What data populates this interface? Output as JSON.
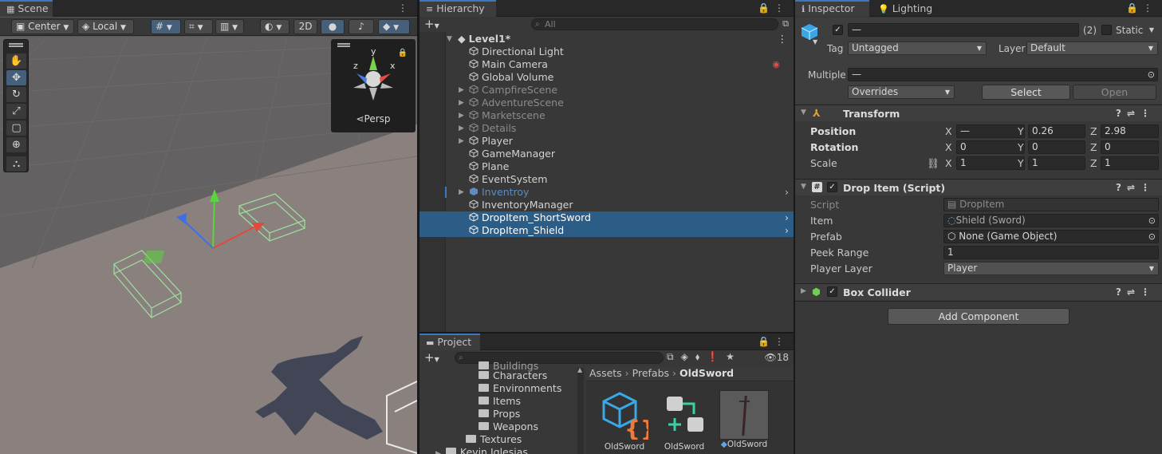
{
  "scene": {
    "tab": "Scene",
    "pivot": "Center",
    "space": "Local",
    "mode_2d": "2D",
    "persp": "Persp",
    "gizmo_axis_y": "y",
    "gizmo_axis_z": "z",
    "gizmo_axis_x": "x"
  },
  "hierarchy": {
    "tab": "Hierarchy",
    "search_placeholder": "All",
    "root": "Level1*",
    "items": [
      {
        "label": "Directional Light"
      },
      {
        "label": "Main Camera"
      },
      {
        "label": "Global Volume"
      },
      {
        "label": "CampfireScene"
      },
      {
        "label": "AdventureScene"
      },
      {
        "label": "Marketscene"
      },
      {
        "label": "Details"
      },
      {
        "label": "Player"
      },
      {
        "label": "GameManager"
      },
      {
        "label": "Plane"
      },
      {
        "label": "EventSystem"
      },
      {
        "label": "Inventroy"
      },
      {
        "label": "InventoryManager"
      },
      {
        "label": "DropItem_ShortSword"
      },
      {
        "label": "DropItem_Shield"
      }
    ]
  },
  "project": {
    "tab": "Project",
    "hidden_count": "18",
    "tree": [
      {
        "label": "Buildings"
      },
      {
        "label": "Characters"
      },
      {
        "label": "Environments"
      },
      {
        "label": "Items"
      },
      {
        "label": "Props"
      },
      {
        "label": "Weapons"
      },
      {
        "label": "Textures"
      },
      {
        "label": "Kevin Iglesias"
      }
    ],
    "breadcrumb": [
      "Assets",
      "Prefabs",
      "OldSword"
    ],
    "assets": [
      {
        "label": "OldSword"
      },
      {
        "label": "OldSword"
      },
      {
        "label": "OldSword"
      }
    ]
  },
  "inspector": {
    "tab": "Inspector",
    "tab2": "Lighting",
    "name_value": "—",
    "count": "(2)",
    "static_label": "Static",
    "tag_label": "Tag",
    "tag_value": "Untagged",
    "layer_label": "Layer",
    "layer_value": "Default",
    "multiple_label": "Multiple",
    "multiple_value": "—",
    "overrides": "Overrides",
    "select": "Select",
    "open": "Open",
    "transform": {
      "title": "Transform",
      "position_label": "Position",
      "rotation_label": "Rotation",
      "scale_label": "Scale",
      "x": "X",
      "y": "Y",
      "z": "Z",
      "position": {
        "x": "—",
        "y": "0.26",
        "z": "2.98"
      },
      "rotation": {
        "x": "0",
        "y": "0",
        "z": "0"
      },
      "scale": {
        "x": "1",
        "y": "1",
        "z": "1"
      }
    },
    "dropitem": {
      "title": "Drop Item (Script)",
      "script_label": "Script",
      "script_value": "DropItem",
      "item_label": "Item",
      "item_value": "Shield (Sword)",
      "prefab_label": "Prefab",
      "prefab_value": "None (Game Object)",
      "peek_label": "Peek Range",
      "peek_value": "1",
      "player_layer_label": "Player Layer",
      "player_layer_value": "Player"
    },
    "boxcollider": {
      "title": "Box Collider"
    },
    "add_component": "Add Component"
  }
}
